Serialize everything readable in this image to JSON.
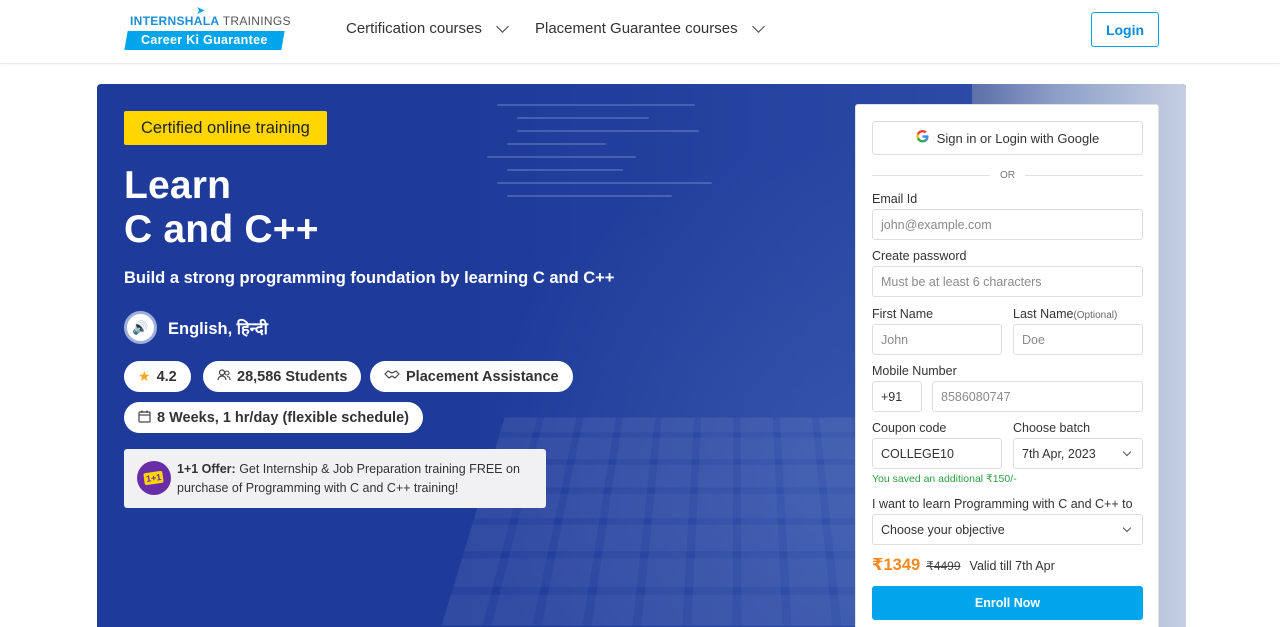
{
  "header": {
    "logo_brand": "INTERNSHALA",
    "logo_suffix": "TRAININGS",
    "logo_tagline": "Career Ki Guarantee",
    "nav": [
      {
        "label": "Certification courses"
      },
      {
        "label": "Placement Guarantee courses"
      }
    ],
    "login_label": "Login"
  },
  "hero": {
    "tag": "Certified online training",
    "title_line1": "Learn",
    "title_line2": "C and C++",
    "subtitle": "Build a strong programming foundation by learning C and C++",
    "languages": "English, हिन्दी",
    "rating": "4.2",
    "students": "28,586 Students",
    "placement": "Placement Assistance",
    "duration": "8 Weeks, 1 hr/day (flexible schedule)",
    "offer_badge": "1+1",
    "offer_prefix": "1+1 Offer:",
    "offer_text": " Get Internship & Job Preparation training FREE on purchase of Programming with C and C++ training!"
  },
  "form": {
    "google_label": "Sign in or Login with Google",
    "or_label": "OR",
    "email_label": "Email Id",
    "email_placeholder": "john@example.com",
    "password_label": "Create password",
    "password_placeholder": "Must be at least 6 characters",
    "first_name_label": "First Name",
    "first_name_placeholder": "John",
    "last_name_label": "Last Name",
    "last_name_optional": "(Optional)",
    "last_name_placeholder": "Doe",
    "mobile_label": "Mobile Number",
    "country_code": "+91",
    "mobile_placeholder": "8586080747",
    "coupon_label": "Coupon code",
    "coupon_value": "COLLEGE10",
    "batch_label": "Choose batch",
    "batch_value": "7th Apr, 2023",
    "saved_text": "You saved an additional ₹150/-",
    "objective_label": "I want to learn Programming with C and C++ to",
    "objective_placeholder": "Choose your objective",
    "price_new": "₹1349",
    "price_old": "₹4499",
    "valid_text": "Valid till 7th Apr",
    "enroll_label": "Enroll Now"
  },
  "colors": {
    "hero_bg": "#1e3a9a",
    "accent_blue": "#00a5ec",
    "tag_yellow": "#ffd600",
    "price_orange": "#f5891f",
    "saved_green": "#2e9e3f"
  },
  "icons": {
    "logo": "paper-plane-icon",
    "nav_chevron": "chevron-down-icon",
    "audio": "speaker-icon",
    "rating": "star-icon",
    "students": "users-icon",
    "placement": "handshake-icon",
    "duration": "calendar-icon",
    "google": "google-icon",
    "select_chevron": "chevron-down-icon"
  }
}
